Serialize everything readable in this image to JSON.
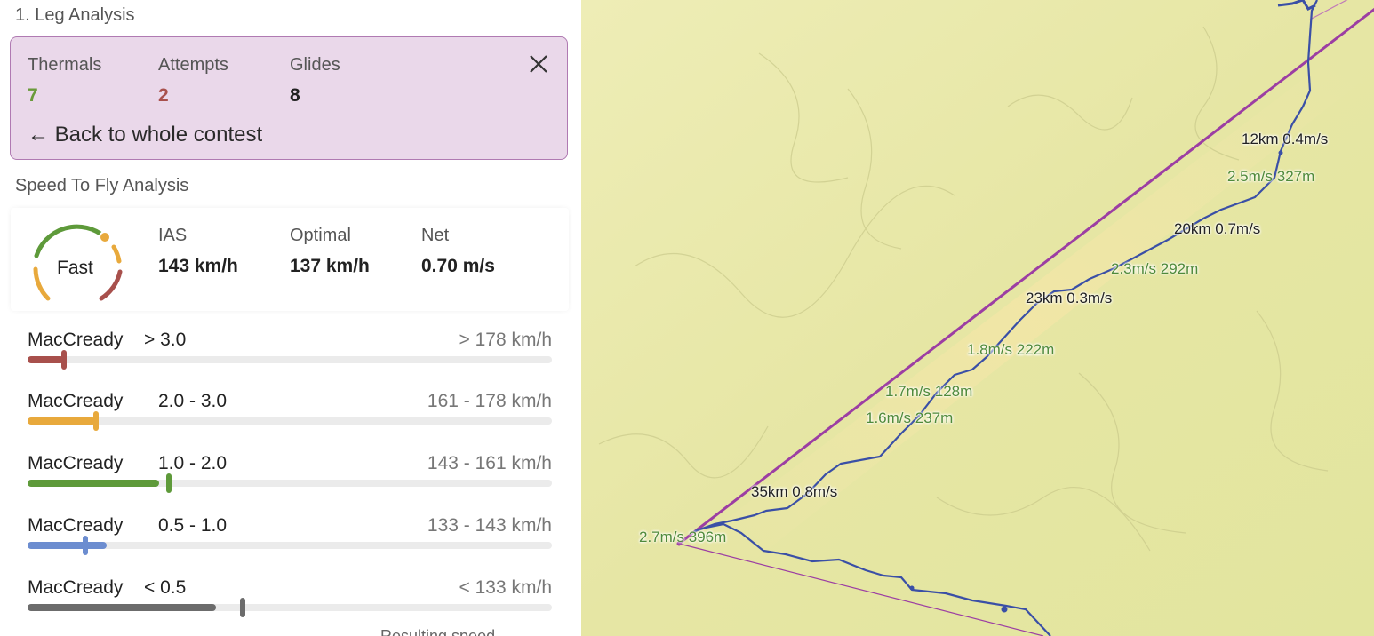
{
  "leg": {
    "title": "1. Leg Analysis",
    "stats": [
      {
        "label": "Thermals",
        "value": "7",
        "color": "#6a9a3a"
      },
      {
        "label": "Attempts",
        "value": "2",
        "color": "#a8504c"
      },
      {
        "label": "Glides",
        "value": "8",
        "color": "#222222"
      }
    ],
    "close_icon": "close-icon",
    "back_label": "← Back to whole contest"
  },
  "stf": {
    "title": "Speed To Fly Analysis",
    "gauge_label": "Fast",
    "gauge_level": 0.86,
    "ias_label": "IAS",
    "ias_value": "143 km/h",
    "optimal_label": "Optimal",
    "optimal_value": "137 km/h",
    "net_label": "Net",
    "net_value": "0.70 m/s"
  },
  "maccready": [
    {
      "name": "MacCready",
      "range": "> 3.0",
      "speed": "> 178 km/h",
      "color": "#a8504c",
      "fill": 0.07,
      "marker": 0.07
    },
    {
      "name": "MacCready",
      "range": "2.0 - 3.0",
      "speed": "161 - 178 km/h",
      "color": "#e8a93c",
      "fill": 0.13,
      "marker": 0.13
    },
    {
      "name": "MacCready",
      "range": "1.0 - 2.0",
      "speed": "143 - 161 km/h",
      "color": "#5e9a3a",
      "fill": 0.25,
      "marker": 0.27
    },
    {
      "name": "MacCready",
      "range": "0.5 - 1.0",
      "speed": "133 - 143 km/h",
      "color": "#6c8dd0",
      "fill": 0.15,
      "marker": 0.11
    },
    {
      "name": "MacCready",
      "range": "< 0.5",
      "speed": "< 133 km/h",
      "color": "#6c6c6c",
      "fill": 0.36,
      "marker": 0.41
    }
  ],
  "bottom_partial": "Resulting speed",
  "map": {
    "colors": {
      "terrain": "#e4e6a2",
      "task_line": "#9c3ea3",
      "track": "#3a4fa6"
    },
    "labels": [
      {
        "text": "12km 0.4m/s",
        "style": "dark"
      },
      {
        "text": "2.5m/s 327m",
        "style": "green"
      },
      {
        "text": "20km 0.7m/s",
        "style": "dark"
      },
      {
        "text": "2.3m/s 292m",
        "style": "green"
      },
      {
        "text": "23km 0.3m/s",
        "style": "dark"
      },
      {
        "text": "1.8m/s 222m",
        "style": "green"
      },
      {
        "text": "1.7m/s 128m",
        "style": "green"
      },
      {
        "text": "1.6m/s 237m",
        "style": "green"
      },
      {
        "text": "35km 0.8m/s",
        "style": "dark"
      },
      {
        "text": "2.7m/s 396m",
        "style": "green"
      }
    ]
  }
}
